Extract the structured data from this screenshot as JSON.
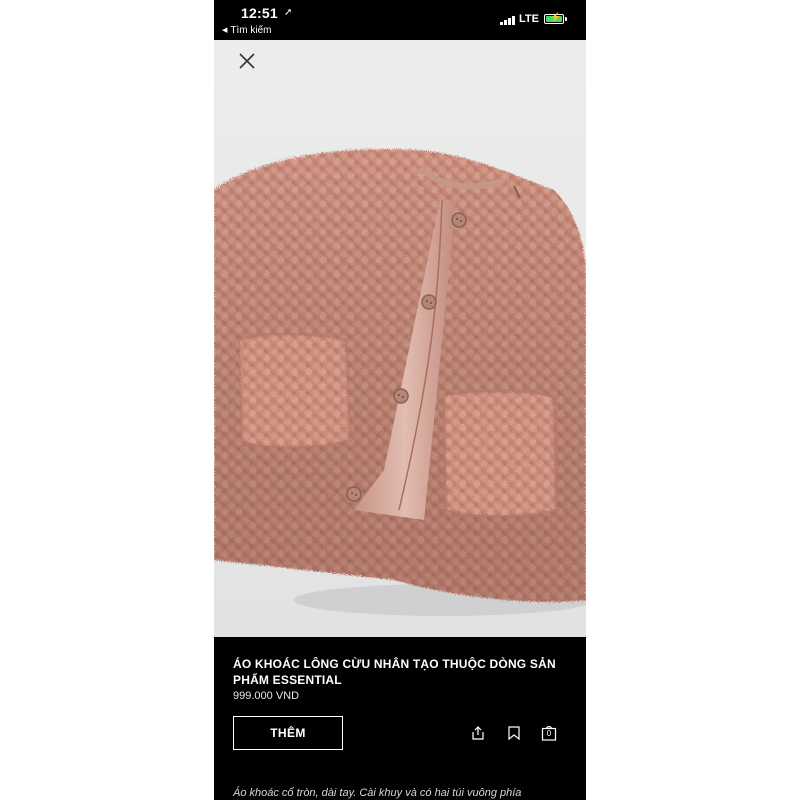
{
  "status_bar": {
    "time": "12:51",
    "location_arrow": "➚",
    "back_label": "Tìm kiếm",
    "carrier": "LTE",
    "battery_charging": true
  },
  "icons": {
    "close": "close-icon",
    "share": "share-icon",
    "bookmark": "bookmark-icon",
    "bag": "shopping-bag-icon"
  },
  "product": {
    "title": "ÁO KHOÁC LÔNG CỪU NHÂN TẠO THUỘC DÒNG SẢN PHẨM ESSENTIAL",
    "price": "999.000 VND",
    "add_button": "THÊM",
    "bag_count": "0",
    "description": "Áo khoác cổ tròn, dài tay. Cài khuy và có hai túi vuông phía"
  },
  "colors": {
    "background": "#000000",
    "text": "#ffffff",
    "jacket": "#c98c7c",
    "photo_bg": "#e8e8e9",
    "battery": "#4cd964"
  }
}
